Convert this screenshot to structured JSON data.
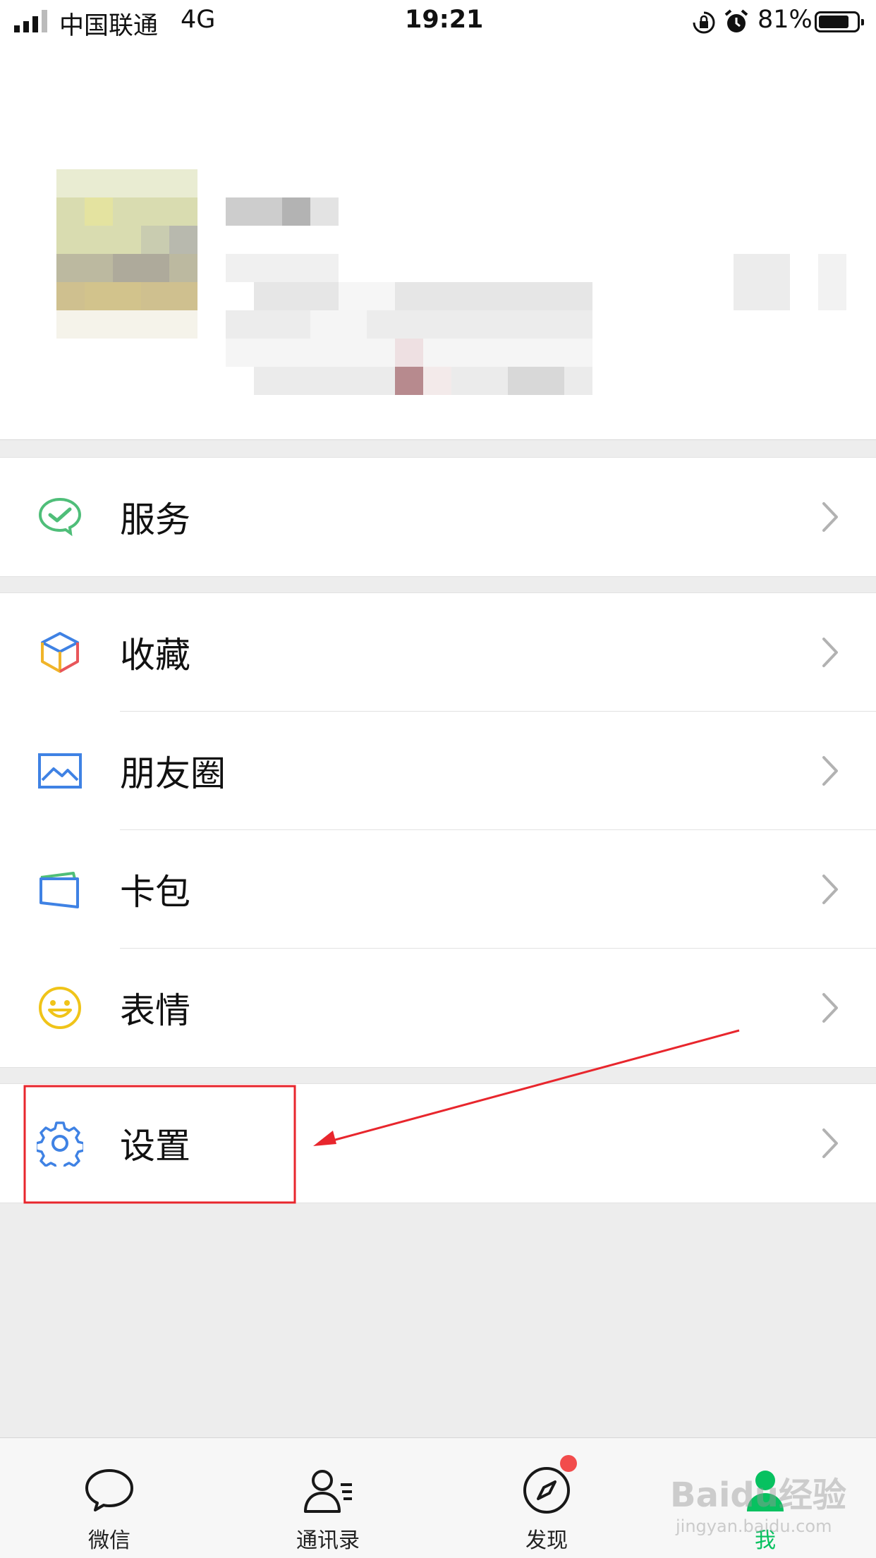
{
  "status_bar": {
    "carrier": "中国联通",
    "network": "4G",
    "time": "19:21",
    "battery": "81%",
    "battery_level": 0.81
  },
  "menu": {
    "services": "服务",
    "favorites": "收藏",
    "moments": "朋友圈",
    "cards": "卡包",
    "stickers": "表情",
    "settings": "设置"
  },
  "tabbar": {
    "chats": "微信",
    "contacts": "通讯录",
    "discover": "发现",
    "me": "我"
  },
  "watermark": {
    "text": "Baidu经验",
    "url": "jingyan.baidu.com"
  },
  "colors": {
    "accent_green": "#07c160",
    "annotation_red": "#e8262d",
    "badge_red": "#f24c4c",
    "chevron_gray": "#b2b2b2"
  }
}
